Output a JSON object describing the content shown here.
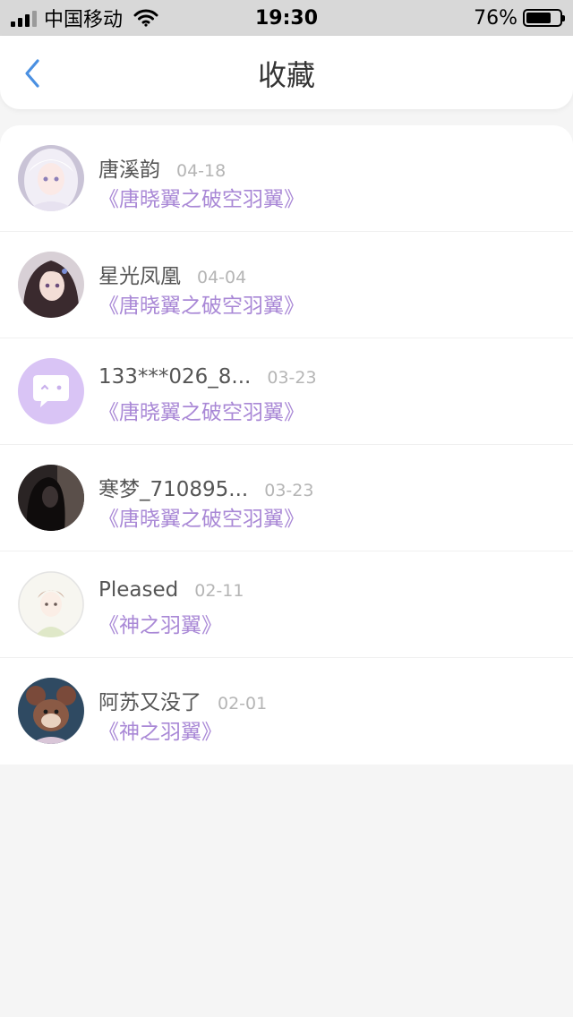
{
  "status_bar": {
    "carrier": "中国移动",
    "time": "19:30",
    "battery_percent": "76%",
    "battery_level": 0.76
  },
  "nav": {
    "title": "收藏",
    "back_icon": "chevron-left-icon",
    "accent_color": "#4a90e2"
  },
  "favorites": [
    {
      "name": "唐溪韵",
      "date": "04-18",
      "book": "《唐晓翼之破空羽翼》",
      "avatar_icon": "avatar-anime-girl-white-hair"
    },
    {
      "name": "星光凤凰",
      "date": "04-04",
      "book": "《唐晓翼之破空羽翼》",
      "avatar_icon": "avatar-anime-girl-dark-hair"
    },
    {
      "name": "133***026_8...",
      "date": "03-23",
      "book": "《唐晓翼之破空羽翼》",
      "avatar_icon": "default-chat-bubble-avatar"
    },
    {
      "name": "寒梦_710895...",
      "date": "03-23",
      "book": "《唐晓翼之破空羽翼》",
      "avatar_icon": "avatar-dark-silhouette"
    },
    {
      "name": "Pleased",
      "date": "02-11",
      "book": "《神之羽翼》",
      "avatar_icon": "avatar-anime-boy-sketch"
    },
    {
      "name": "阿苏又没了",
      "date": "02-01",
      "book": "《神之羽翼》",
      "avatar_icon": "avatar-cartoon-mouse"
    }
  ],
  "colors": {
    "book_title": "#a988d6",
    "date": "#b5b5b5",
    "default_avatar_bg": "#d9c4f5"
  }
}
